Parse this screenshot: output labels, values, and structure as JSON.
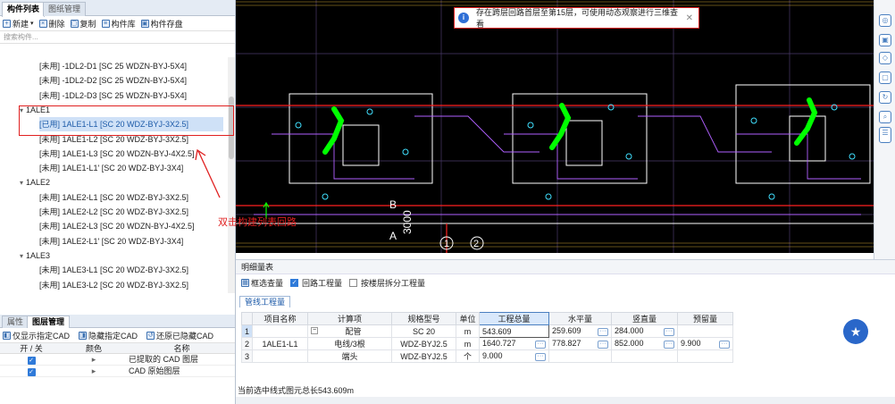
{
  "left_panel": {
    "tabs": [
      "构件列表",
      "图纸管理"
    ],
    "toolbar": {
      "new": "新建",
      "delete": "删除",
      "copy": "复制",
      "library": "构件库",
      "save": "构件存盘"
    },
    "search_placeholder": "搜索构件...",
    "tree": [
      {
        "kind": "item",
        "label": "[未用] -1DL2-D1 [SC 25 WDZN-BYJ-5X4]"
      },
      {
        "kind": "item",
        "label": "[未用] -1DL2-D2 [SC 25 WDZN-BYJ-5X4]"
      },
      {
        "kind": "item",
        "label": "[未用] -1DL2-D3 [SC 25 WDZN-BYJ-5X4]"
      },
      {
        "kind": "group",
        "label": "1ALE1"
      },
      {
        "kind": "item",
        "label": "[已用] 1ALE1-L1 [SC 20 WDZ-BYJ-3X2.5]",
        "selected": true
      },
      {
        "kind": "item",
        "label": "[未用] 1ALE1-L2 [SC 20 WDZ-BYJ-3X2.5]"
      },
      {
        "kind": "item",
        "label": "[未用] 1ALE1-L3 [SC 20 WDZN-BYJ-4X2.5]"
      },
      {
        "kind": "item",
        "label": "[未用] 1ALE1-L1' [SC 20 WDZ-BYJ-3X4]"
      },
      {
        "kind": "group",
        "label": "1ALE2"
      },
      {
        "kind": "item",
        "label": "[未用] 1ALE2-L1 [SC 20 WDZ-BYJ-3X2.5]"
      },
      {
        "kind": "item",
        "label": "[未用] 1ALE2-L2 [SC 20 WDZ-BYJ-3X2.5]"
      },
      {
        "kind": "item",
        "label": "[未用] 1ALE2-L3 [SC 20 WDZN-BYJ-4X2.5]"
      },
      {
        "kind": "item",
        "label": "[未用] 1ALE2-L1' [SC 20 WDZ-BYJ-3X4]"
      },
      {
        "kind": "group",
        "label": "1ALE3"
      },
      {
        "kind": "item",
        "label": "[未用] 1ALE3-L1 [SC 20 WDZ-BYJ-3X2.5]"
      },
      {
        "kind": "item",
        "label": "[未用] 1ALE3-L2 [SC 20 WDZ-BYJ-3X2.5]"
      }
    ],
    "bottom_tabs": [
      "属性",
      "图层管理"
    ],
    "layer_toolbar": {
      "show": "仅显示指定CAD",
      "hide": "隐藏指定CAD",
      "restore": "还原已隐藏CAD"
    },
    "layer_headers": [
      "开 / 关",
      "颜色",
      "名称"
    ],
    "layers": [
      {
        "name": "已提取的 CAD 图层"
      },
      {
        "name": "CAD 原始图层"
      }
    ]
  },
  "cad": {
    "notice": "存在跨层回路首层至第15层，可使用动态观察进行三维查看",
    "labels": {
      "b": "B",
      "a": "A",
      "dim": "3000",
      "n1": "1",
      "n2": "2"
    },
    "accent": "#00ff00"
  },
  "annotation": "双击构建列表回路",
  "detail": {
    "title": "明细量表",
    "tools": {
      "filter": "框选查量",
      "loop": "回路工程量",
      "split": "按楼层拆分工程量"
    },
    "tab": "管线工程量",
    "headers": [
      "",
      "项目名称",
      "计算项",
      "规格型号",
      "单位",
      "工程总量",
      "水平量",
      "竖直量",
      "预留量"
    ],
    "rows": [
      {
        "no": "1",
        "project": "",
        "item": "配管",
        "spec": "SC 20",
        "unit": "m",
        "total": "543.609",
        "horizontal": "259.609",
        "vertical": "284.000",
        "reserve": ""
      },
      {
        "no": "2",
        "project": "1ALE1-L1",
        "item": "电线/3根",
        "spec": "WDZ-BYJ2.5",
        "unit": "m",
        "total": "1640.727",
        "horizontal": "778.827",
        "vertical": "852.000",
        "reserve": "9.900"
      },
      {
        "no": "3",
        "project": "",
        "item": "端头",
        "spec": "WDZ-BYJ2.5",
        "unit": "个",
        "total": "9.000",
        "horizontal": "",
        "vertical": "",
        "reserve": ""
      }
    ],
    "status": "当前选中线式图元总长543.609m"
  }
}
